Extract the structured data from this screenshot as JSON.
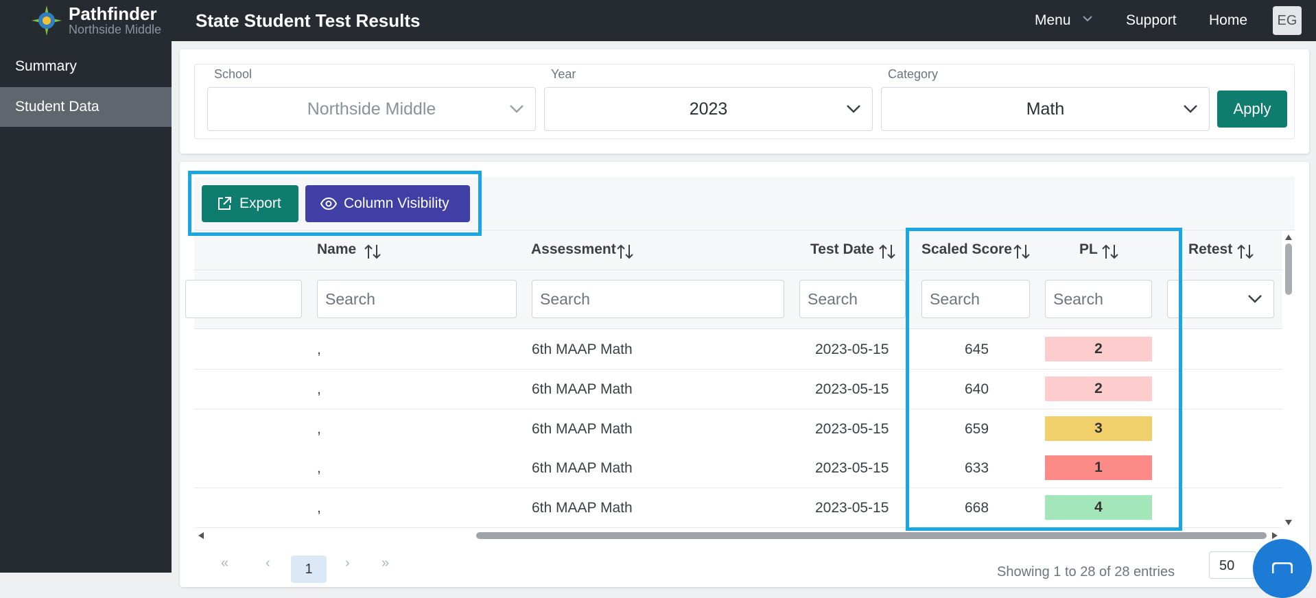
{
  "app": {
    "name": "Pathfinder",
    "school_subtitle": "Northside Middle",
    "page_title": "State Student Test Results"
  },
  "nav": {
    "menu": "Menu",
    "support": "Support",
    "home": "Home",
    "avatar_initials": "EG"
  },
  "sidebar": {
    "items": [
      {
        "label": "Summary"
      },
      {
        "label": "Student Data"
      }
    ]
  },
  "filters": {
    "school": {
      "label": "School",
      "value": "Northside Middle"
    },
    "year": {
      "label": "Year",
      "value": "2023"
    },
    "category": {
      "label": "Category",
      "value": "Math"
    },
    "apply": "Apply"
  },
  "toolbar": {
    "export": "Export",
    "column_visibility": "Column Visibility"
  },
  "table": {
    "columns": [
      "Name",
      "Assessment",
      "Test Date",
      "Scaled Score",
      "PL",
      "Retest"
    ],
    "search_placeholder": "Search",
    "rows": [
      {
        "name": ",",
        "assessment": "6th MAAP Math",
        "test_date": "2023-05-15",
        "scaled_score": "645",
        "pl": "2"
      },
      {
        "name": ",",
        "assessment": "6th MAAP Math",
        "test_date": "2023-05-15",
        "scaled_score": "640",
        "pl": "2"
      },
      {
        "name": ",",
        "assessment": "6th MAAP Math",
        "test_date": "2023-05-15",
        "scaled_score": "659",
        "pl": "3"
      },
      {
        "name": ",",
        "assessment": "6th MAAP Math",
        "test_date": "2023-05-15",
        "scaled_score": "633",
        "pl": "1"
      },
      {
        "name": ",",
        "assessment": "6th MAAP Math",
        "test_date": "2023-05-15",
        "scaled_score": "668",
        "pl": "4"
      }
    ]
  },
  "pl_colors": {
    "1": "#fc8a86",
    "2": "#fdcdcd",
    "3": "#f1d06b",
    "4": "#a3e6b9"
  },
  "pagination": {
    "current_page": "1",
    "first": "«",
    "prev": "‹",
    "next": "›",
    "last": "»",
    "summary": "Showing 1 to 28 of 28 entries",
    "page_size": "50"
  },
  "colors": {
    "nav_bg": "#252b31",
    "accent_green": "#0e7c6e",
    "accent_indigo": "#3f3fa6",
    "highlight_blue": "#1aa6e0"
  }
}
